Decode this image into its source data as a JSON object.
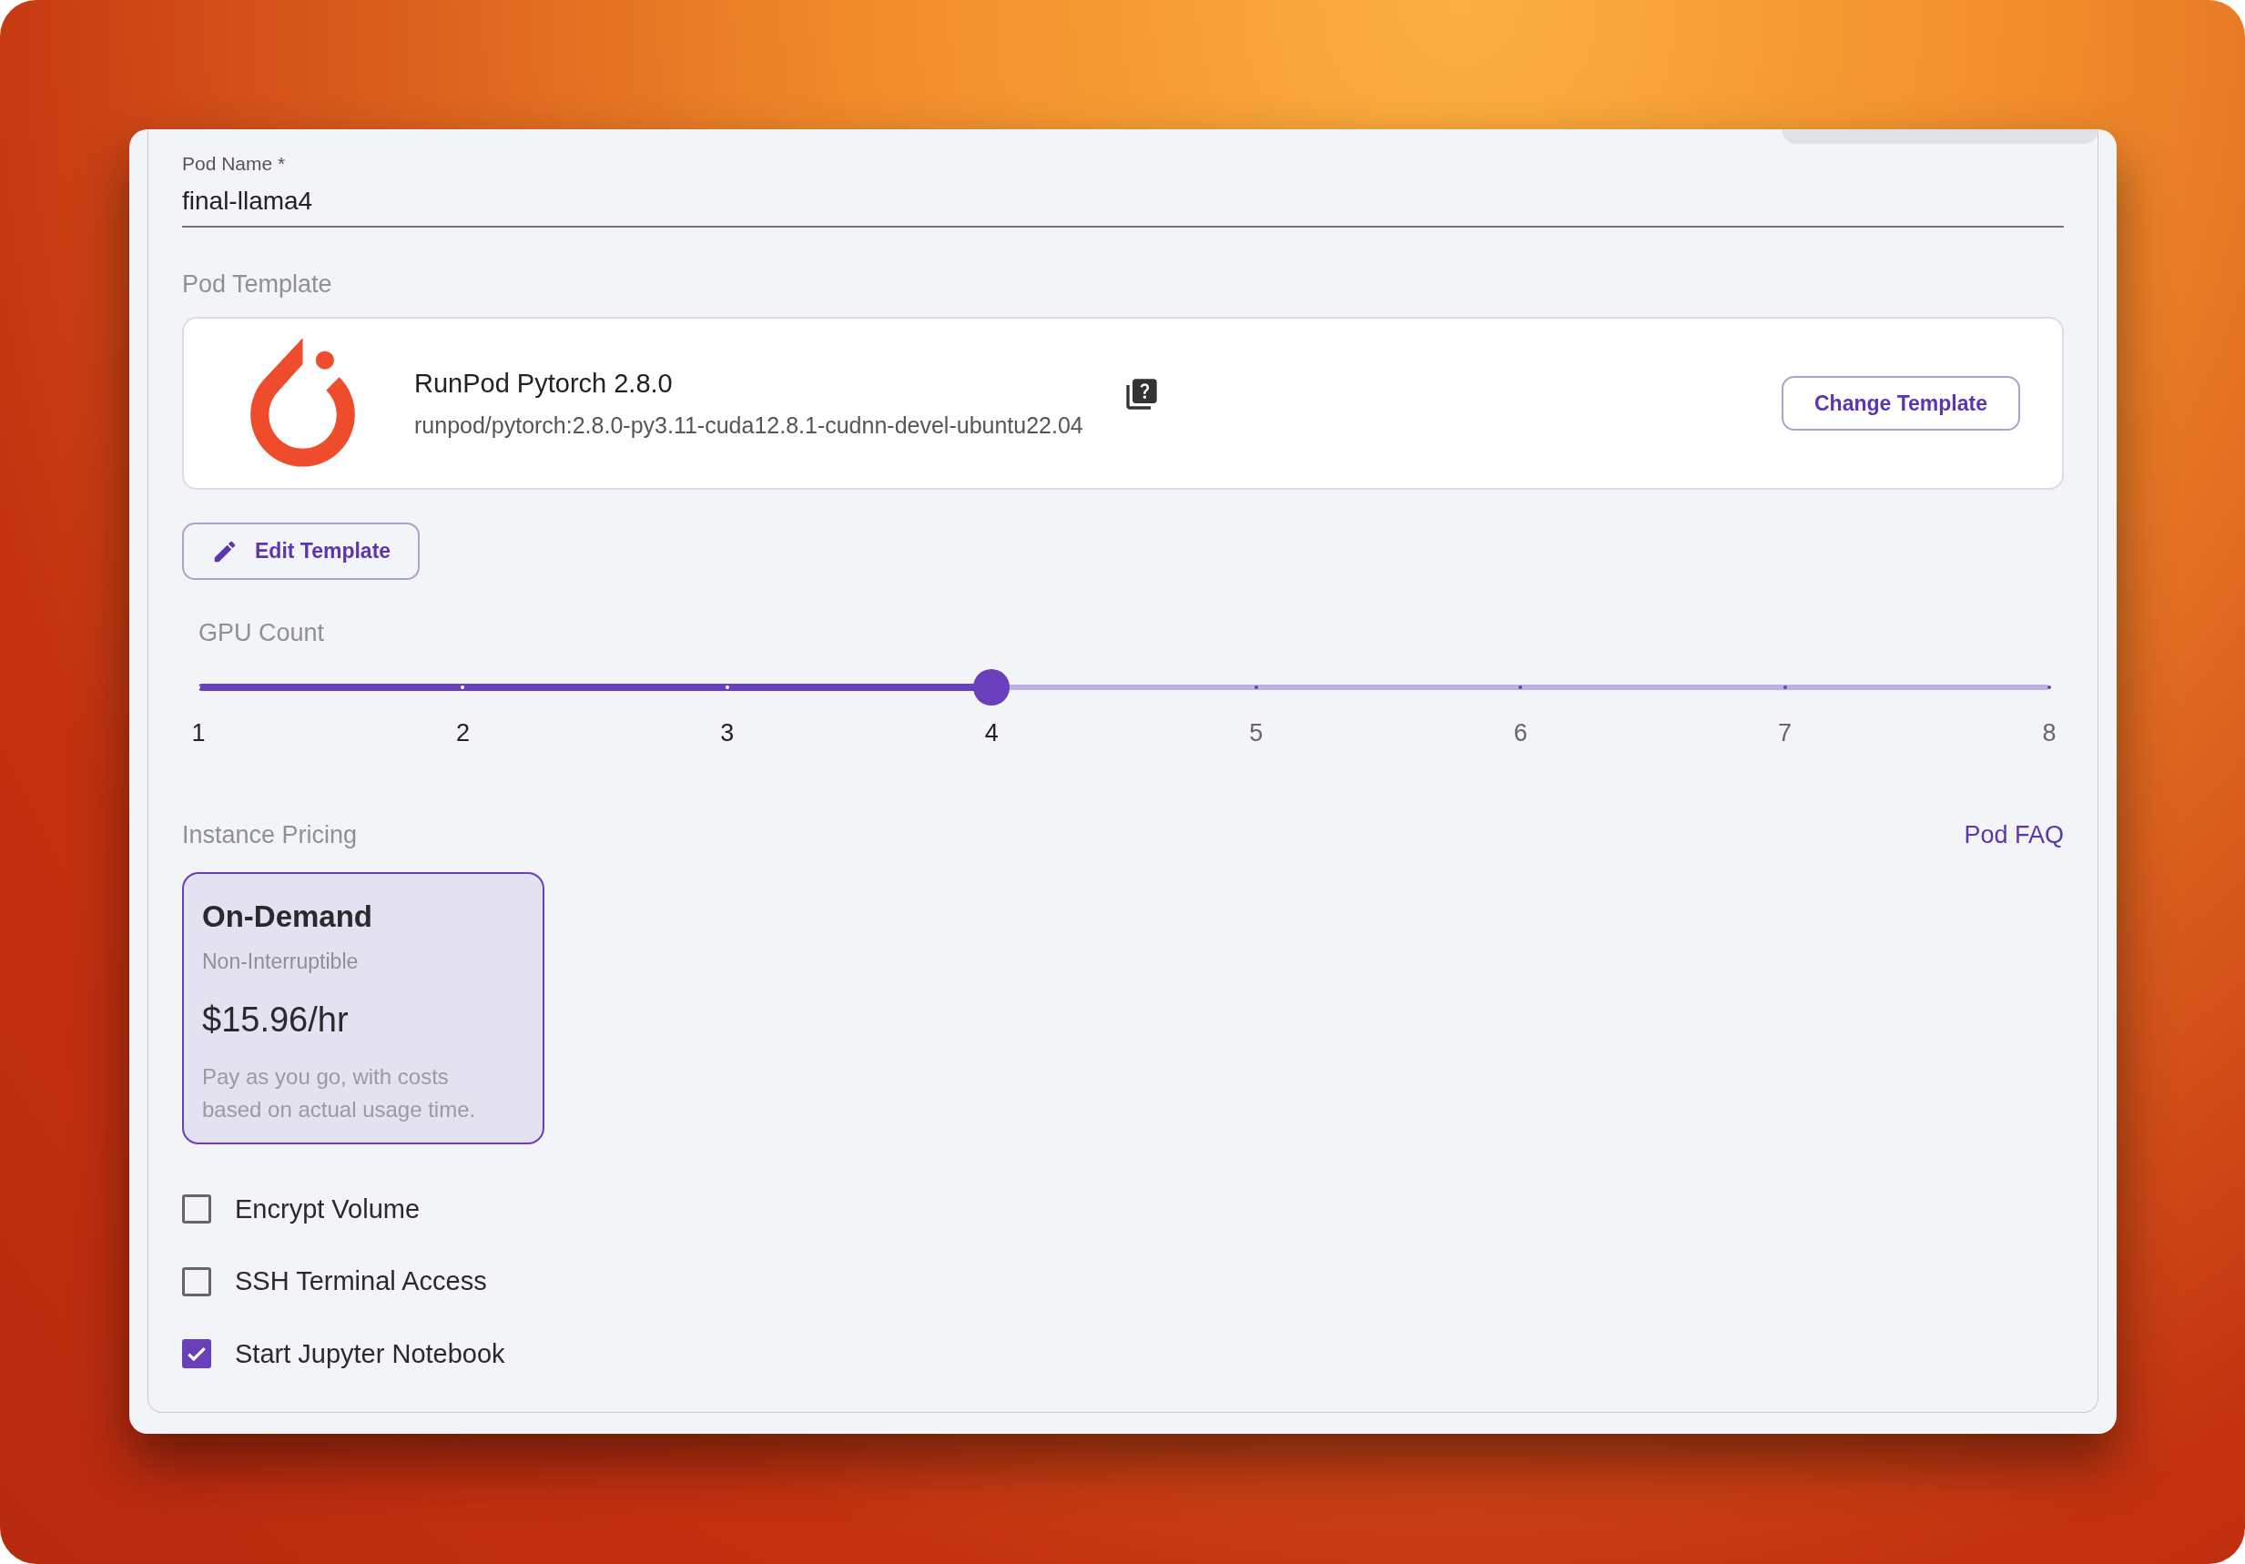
{
  "pod_name": {
    "label": "Pod Name",
    "required_mark": "*",
    "value": "final-llama4"
  },
  "pod_template": {
    "label": "Pod Template",
    "name": "RunPod Pytorch 2.8.0",
    "image": "runpod/pytorch:2.8.0-py3.11-cuda12.8.1-cudnn-devel-ubuntu22.04",
    "change_button": "Change Template",
    "edit_button": "Edit Template"
  },
  "gpu_count": {
    "label": "GPU Count",
    "level": 0.4286,
    "ticks": [
      "1",
      "2",
      "3",
      "4",
      "5",
      "6",
      "7",
      "8"
    ]
  },
  "instance_pricing": {
    "label": "Instance Pricing",
    "faq_link": "Pod FAQ",
    "options": [
      {
        "title": "On-Demand",
        "subtitle": "Non-Interruptible",
        "price": "$15.96/hr",
        "description": "Pay as you go, with costs based on actual usage time.",
        "selected": true
      }
    ]
  },
  "options": [
    {
      "label": "Encrypt Volume",
      "checked": false
    },
    {
      "label": "SSH Terminal Access",
      "checked": false
    },
    {
      "label": "Start Jupyter Notebook",
      "checked": true
    }
  ]
}
